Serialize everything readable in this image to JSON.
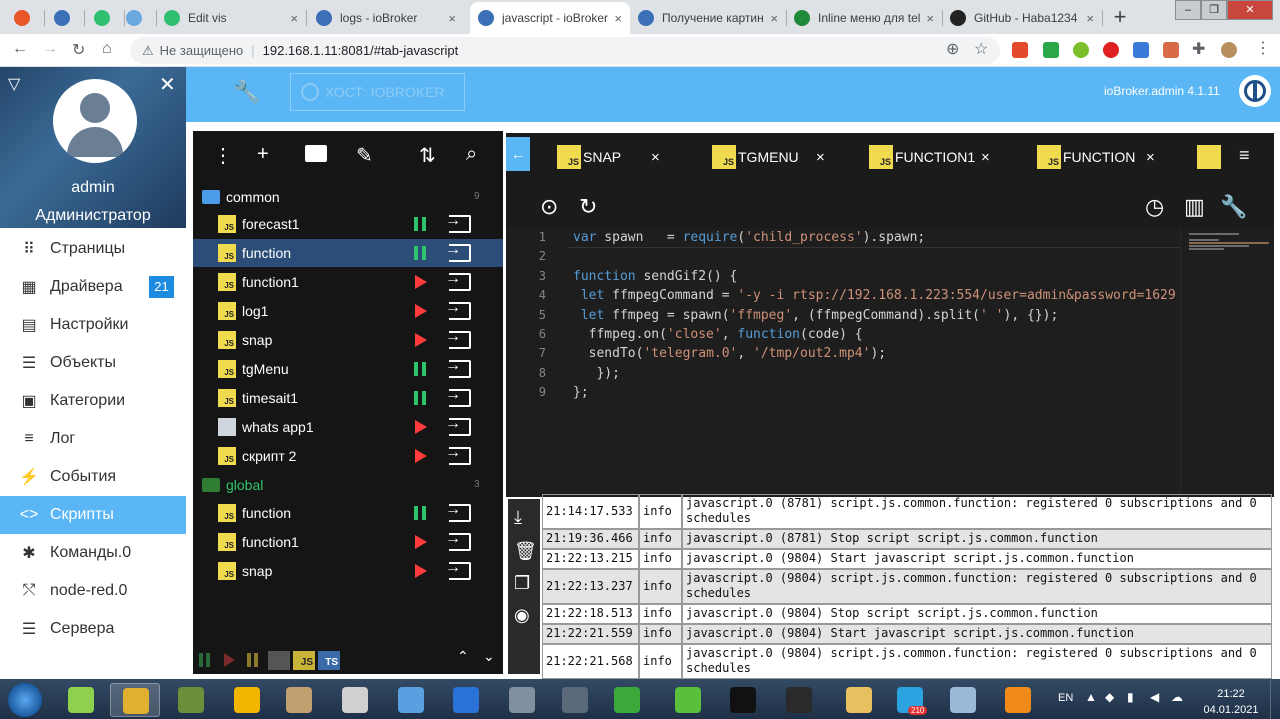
{
  "browser": {
    "tabs": [
      {
        "label": "",
        "icon_color": "#e8562a"
      },
      {
        "label": "",
        "icon_color": "#3b6fb6"
      },
      {
        "label": "",
        "icon_color": "#2fbf71"
      },
      {
        "label": "",
        "icon_color": "#6aa9e0"
      },
      {
        "label": "Edit vis",
        "icon_color": "#2fbf71"
      },
      {
        "label": "logs - ioBroker",
        "icon_color": "#3b6fb6"
      },
      {
        "label": "javascript - ioBroker",
        "icon_color": "#3b6fb6"
      },
      {
        "label": "Получение картин",
        "icon_color": "#3b6fb6"
      },
      {
        "label": "Inline меню для tel",
        "icon_color": "#1e8a3a"
      },
      {
        "label": "GitHub - Haba1234",
        "icon_color": "#222222"
      }
    ],
    "tab_close": "×",
    "new_tab": "+",
    "url_security": "Не защищено",
    "url": "192.168.1.11:8081/#tab-javascript"
  },
  "header": {
    "host_label": "ХОСТ: IOBROKER",
    "version": "ioBroker.admin 4.1.11"
  },
  "sidebar": {
    "user": "admin",
    "role": "Администратор",
    "items": [
      {
        "label": "Страницы",
        "icon": "grid-icon",
        "glyph": "⠿"
      },
      {
        "label": "Драйвера",
        "icon": "store-icon",
        "glyph": "▦",
        "badge": "21"
      },
      {
        "label": "Настройки",
        "icon": "settings-icon",
        "glyph": "▤"
      },
      {
        "label": "Объекты",
        "icon": "list-icon",
        "glyph": "☰"
      },
      {
        "label": "Категории",
        "icon": "category-icon",
        "glyph": "▣"
      },
      {
        "label": "Лог",
        "icon": "log-icon",
        "glyph": "≡"
      },
      {
        "label": "События",
        "icon": "bolt-icon",
        "glyph": "⚡"
      },
      {
        "label": "Скрипты",
        "icon": "code-icon",
        "glyph": "<>",
        "active": true
      },
      {
        "label": "Команды.0",
        "icon": "asterisk-icon",
        "glyph": "✱"
      },
      {
        "label": "node-red.0",
        "icon": "node-icon",
        "glyph": "⤲"
      },
      {
        "label": "Сервера",
        "icon": "server-icon",
        "glyph": "☰"
      }
    ]
  },
  "tree": {
    "common_folder": "common",
    "common_count": "9",
    "common_scripts": [
      {
        "name": "forecast1",
        "state": "running"
      },
      {
        "name": "function",
        "state": "running",
        "selected": true
      },
      {
        "name": "function1",
        "state": "stopped"
      },
      {
        "name": "log1",
        "state": "stopped"
      },
      {
        "name": "snap",
        "state": "stopped"
      },
      {
        "name": "tgMenu",
        "state": "running"
      },
      {
        "name": "timesait1",
        "state": "running"
      },
      {
        "name": "whats app1",
        "state": "stopped"
      },
      {
        "name": "скрипт 2",
        "state": "stopped"
      }
    ],
    "global_folder": "global",
    "global_count": "3",
    "global_scripts": [
      {
        "name": "function",
        "state": "running"
      },
      {
        "name": "function1",
        "state": "stopped"
      },
      {
        "name": "snap",
        "state": "stopped"
      }
    ],
    "js_badge": "JS",
    "ts_badge": "TS"
  },
  "editor": {
    "tabs": [
      {
        "label": "SNAP"
      },
      {
        "label": "TGMENU"
      },
      {
        "label": "FUNCTION1"
      },
      {
        "label": "FUNCTION"
      }
    ],
    "code": [
      [
        {
          "t": "var",
          "c": "kw"
        },
        {
          "t": " spawn   = "
        },
        {
          "t": "require",
          "c": "kw"
        },
        {
          "t": "("
        },
        {
          "t": "'child_process'",
          "c": "str"
        },
        {
          "t": ").spawn;"
        }
      ],
      [],
      [
        {
          "t": "function",
          "c": "kw"
        },
        {
          "t": " sendGif2() {"
        }
      ],
      [
        {
          "t": " "
        },
        {
          "t": "let",
          "c": "kw"
        },
        {
          "t": " ffmpegCommand = "
        },
        {
          "t": "'-y -i rtsp://192.168.1.223:554/user=admin&password=1629",
          "c": "str"
        }
      ],
      [
        {
          "t": " "
        },
        {
          "t": "let",
          "c": "kw"
        },
        {
          "t": " ffmpeg = spawn("
        },
        {
          "t": "'ffmpeg'",
          "c": "str"
        },
        {
          "t": ", (ffmpegCommand).split("
        },
        {
          "t": "' '",
          "c": "str"
        },
        {
          "t": "), {});"
        }
      ],
      [
        {
          "t": "  ffmpeg.on("
        },
        {
          "t": "'close'",
          "c": "str"
        },
        {
          "t": ", "
        },
        {
          "t": "function",
          "c": "kw"
        },
        {
          "t": "(code) {"
        }
      ],
      [
        {
          "t": "  sendTo("
        },
        {
          "t": "'telegram.0'",
          "c": "str"
        },
        {
          "t": ", "
        },
        {
          "t": "'/tmp/out2.mp4'",
          "c": "str"
        },
        {
          "t": ");"
        }
      ],
      [
        {
          "t": "   });"
        }
      ],
      [
        {
          "t": "};"
        }
      ]
    ]
  },
  "log": {
    "rows": [
      {
        "time": "21:14:17.533",
        "level": "info",
        "msg": "javascript.0 (8781) script.js.common.function: registered 0 subscriptions and 0 schedules",
        "lines": 2,
        "partial": true
      },
      {
        "time": "21:19:36.466",
        "level": "info",
        "msg": "javascript.0 (8781) Stop script script.js.common.function",
        "lines": 1
      },
      {
        "time": "21:22:13.215",
        "level": "info",
        "msg": "javascript.0 (9804) Start javascript script.js.common.function",
        "lines": 1
      },
      {
        "time": "21:22:13.237",
        "level": "info",
        "msg": "javascript.0 (9804) script.js.common.function: registered 0 subscriptions and 0 schedules",
        "lines": 2
      },
      {
        "time": "21:22:18.513",
        "level": "info",
        "msg": "javascript.0 (9804) Stop script script.js.common.function",
        "lines": 1
      },
      {
        "time": "21:22:21.559",
        "level": "info",
        "msg": "javascript.0 (9804) Start javascript script.js.common.function",
        "lines": 1
      },
      {
        "time": "21:22:21.568",
        "level": "info",
        "msg": "javascript.0 (9804) script.js.common.function: registered 0 subscriptions and 0 schedules",
        "lines": 2
      }
    ]
  },
  "taskbar": {
    "lang": "EN",
    "time": "21:22",
    "date": "04.01.2021",
    "telegram_badge": "210",
    "apps": [
      {
        "icon": "cube-icon",
        "color": "#8fd14f"
      },
      {
        "icon": "chrome-icon",
        "color": "#e0b030",
        "active": true
      },
      {
        "icon": "minecraft-icon",
        "color": "#6b8e3a"
      },
      {
        "icon": "rockstar-icon",
        "color": "#f2b600"
      },
      {
        "icon": "brush-icon",
        "color": "#c0a070"
      },
      {
        "icon": "editor-icon",
        "color": "#d0d0d0"
      },
      {
        "icon": "puzzle-icon",
        "color": "#5aa0e0"
      },
      {
        "icon": "cloud-icon",
        "color": "#2a72d8"
      },
      {
        "icon": "usb-icon",
        "color": "#8090a0"
      },
      {
        "icon": "lock-icon",
        "color": "#5a6a7a"
      },
      {
        "icon": "leaf-icon",
        "color": "#3ba83b"
      },
      {
        "icon": "utorrent-icon",
        "color": "#5abf3a"
      },
      {
        "icon": "epic-icon",
        "color": "#111111"
      },
      {
        "icon": "pubg-icon",
        "color": "#2a2a2a"
      },
      {
        "icon": "folder-icon",
        "color": "#e8c060"
      },
      {
        "icon": "telegram-icon",
        "color": "#2aa3e0"
      },
      {
        "icon": "window-icon",
        "color": "#9ab8d8"
      },
      {
        "icon": "vlc-icon",
        "color": "#f08a1a"
      }
    ]
  }
}
